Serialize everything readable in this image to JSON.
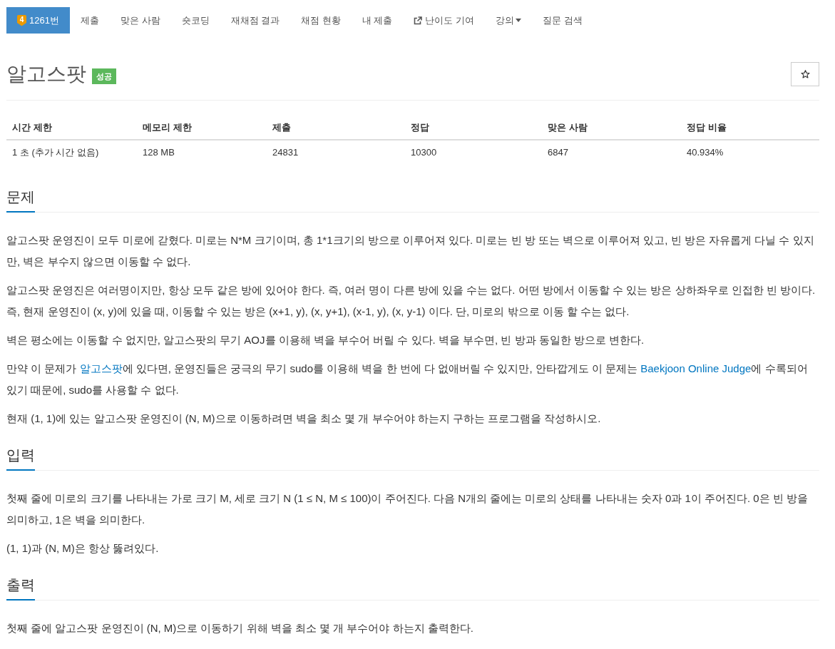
{
  "nav": {
    "tabs": [
      {
        "kind": "problem",
        "label": "1261번",
        "tier": "4",
        "selected": true
      },
      {
        "kind": "plain",
        "label": "제출",
        "selected": false
      },
      {
        "kind": "plain",
        "label": "맞은 사람",
        "selected": false
      },
      {
        "kind": "plain",
        "label": "숏코딩",
        "selected": false
      },
      {
        "kind": "plain",
        "label": "재채점 결과",
        "selected": false
      },
      {
        "kind": "plain",
        "label": "채점 현황",
        "selected": false
      },
      {
        "kind": "plain",
        "label": "내 제출",
        "selected": false
      },
      {
        "kind": "external",
        "label": "난이도 기여",
        "selected": false
      },
      {
        "kind": "dropdown",
        "label": "강의",
        "selected": false
      },
      {
        "kind": "plain",
        "label": "질문 검색",
        "selected": false
      }
    ]
  },
  "problem": {
    "title": "알고스팟",
    "result": "성공"
  },
  "stats": {
    "columns": [
      "시간 제한",
      "메모리 제한",
      "제출",
      "정답",
      "맞은 사람",
      "정답 비율"
    ],
    "rows": [
      [
        "1 초 (추가 시간 없음)",
        "128 MB",
        "24831",
        "10300",
        "6847",
        "40.934%"
      ]
    ]
  },
  "sections": [
    {
      "heading": "문제",
      "paragraphs": [
        [
          {
            "kind": "text",
            "text": "알고스팟 운영진이 모두 미로에 갇혔다. 미로는 N*M 크기이며, 총 1*1크기의 방으로 이루어져 있다. 미로는 빈 방 또는 벽으로 이루어져 있고, 빈 방은 자유롭게 다닐 수 있지만, 벽은 부수지 않으면 이동할 수 없다."
          }
        ],
        [
          {
            "kind": "text",
            "text": "알고스팟 운영진은 여러명이지만, 항상 모두 같은 방에 있어야 한다. 즉, 여러 명이 다른 방에 있을 수는 없다. 어떤 방에서 이동할 수 있는 방은 상하좌우로 인접한 빈 방이다. 즉, 현재 운영진이 (x, y)에 있을 때, 이동할 수 있는 방은 (x+1, y), (x, y+1), (x-1, y), (x, y-1) 이다. 단, 미로의 밖으로 이동 할 수는 없다."
          }
        ],
        [
          {
            "kind": "text",
            "text": "벽은 평소에는 이동할 수 없지만, 알고스팟의 무기 AOJ를 이용해 벽을 부수어 버릴 수 있다. 벽을 부수면, 빈 방과 동일한 방으로 변한다."
          }
        ],
        [
          {
            "kind": "text",
            "text": "만약 이 문제가 "
          },
          {
            "kind": "link",
            "text": "알고스팟"
          },
          {
            "kind": "text",
            "text": "에 있다면, 운영진들은 궁극의 무기 sudo를 이용해 벽을 한 번에 다 없애버릴 수 있지만, 안타깝게도 이 문제는 "
          },
          {
            "kind": "link",
            "text": "Baekjoon Online Judge"
          },
          {
            "kind": "text",
            "text": "에 수록되어 있기 때문에, sudo를 사용할 수 없다."
          }
        ],
        [
          {
            "kind": "text",
            "text": "현재 (1, 1)에 있는 알고스팟 운영진이 (N, M)으로 이동하려면 벽을 최소 몇 개 부수어야 하는지 구하는 프로그램을 작성하시오."
          }
        ]
      ]
    },
    {
      "heading": "입력",
      "paragraphs": [
        [
          {
            "kind": "text",
            "text": "첫째 줄에 미로의 크기를 나타내는 가로 크기 M, 세로 크기 N (1 ≤ N, M ≤ 100)이 주어진다. 다음 N개의 줄에는 미로의 상태를 나타내는 숫자 0과 1이 주어진다. 0은 빈 방을 의미하고, 1은 벽을 의미한다."
          }
        ],
        [
          {
            "kind": "text",
            "text": "(1, 1)과 (N, M)은 항상 뚫려있다."
          }
        ]
      ]
    },
    {
      "heading": "출력",
      "paragraphs": [
        [
          {
            "kind": "text",
            "text": "첫째 줄에 알고스팟 운영진이 (N, M)으로 이동하기 위해 벽을 최소 몇 개 부수어야 하는지 출력한다."
          }
        ]
      ]
    }
  ]
}
